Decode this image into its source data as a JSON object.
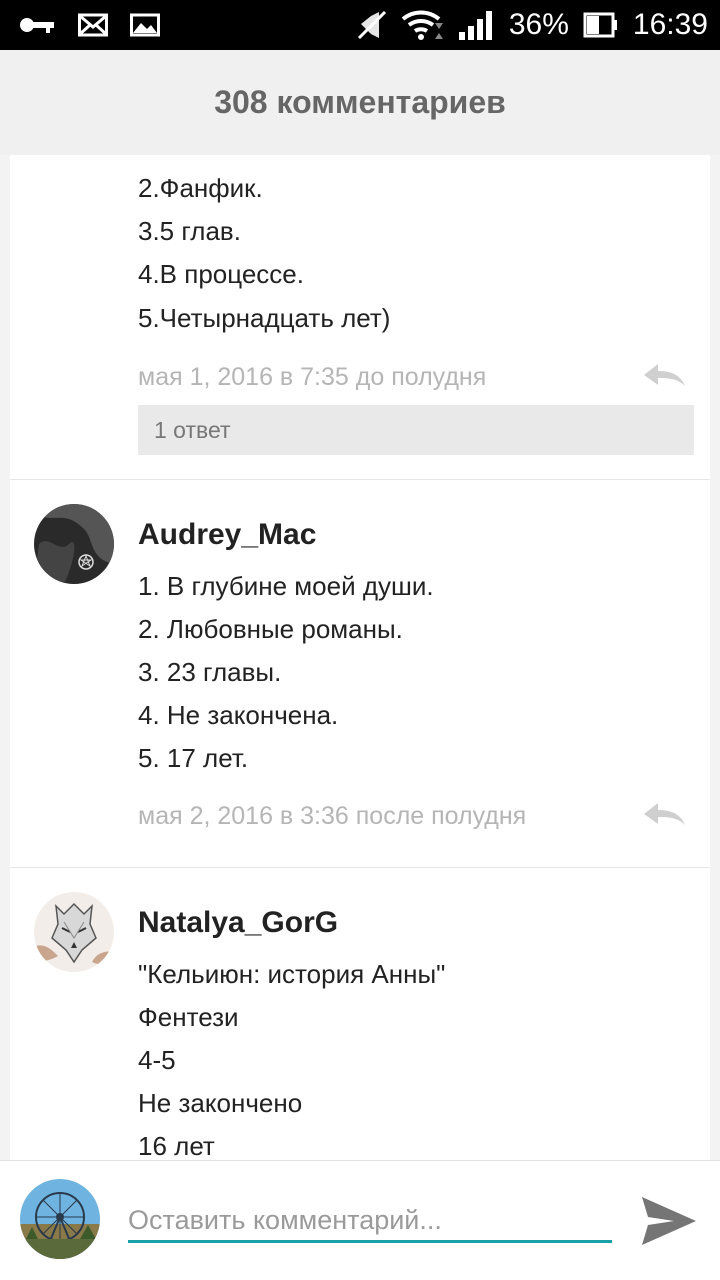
{
  "status_bar": {
    "battery": "36%",
    "time": "16:39",
    "icons": [
      "key-icon",
      "mail-icon",
      "image-icon",
      "mute-icon",
      "wifi-icon",
      "signal-icon",
      "battery-icon"
    ]
  },
  "header": {
    "title": "308 комментариев"
  },
  "comments": [
    {
      "lines": [
        "2.Фанфик.",
        "3.5 глав.",
        "4.В процессе.",
        "5.Четырнадцать лет)"
      ],
      "date": "мая 1, 2016 в 7:35 до полудня",
      "replies": "1 ответ"
    },
    {
      "author": "Audrey_Mac",
      "lines": [
        "1. В глубине моей души.",
        "2. Любовные романы.",
        "3. 23 главы.",
        "4. Не закончена.",
        "5. 17 лет."
      ],
      "date": "мая 2, 2016 в 3:36 после полудня"
    },
    {
      "author": "Natalya_GorG",
      "lines": [
        "\"Кельиюн: история Анны\"",
        "Фентези",
        "4-5",
        "Не закончено",
        "16 лет"
      ]
    }
  ],
  "composer": {
    "placeholder": "Оставить комментарий..."
  },
  "colors": {
    "accent": "#19a0a8",
    "muted": "#b5b5b5",
    "header_text": "#666666"
  }
}
